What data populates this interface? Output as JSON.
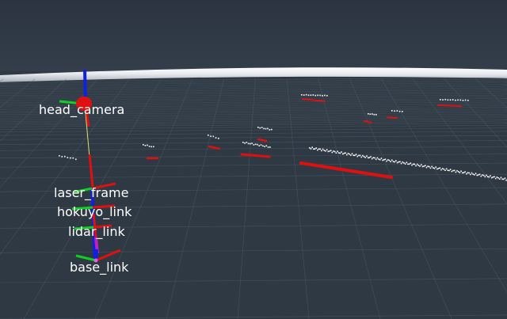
{
  "viewport": {
    "background_color": "#2f3a45",
    "sky_color": "#303947",
    "ground_color": "#2e3943",
    "grid_color": "#566472",
    "horizon_color": "#e6e9ed"
  },
  "frames": [
    {
      "id": "head_camera",
      "label": "head_camera"
    },
    {
      "id": "laser_frame",
      "label": "laser_frame"
    },
    {
      "id": "hokuyo_link",
      "label": "hokuyo_link"
    },
    {
      "id": "lidar_link",
      "label": "lidar_link"
    },
    {
      "id": "base_link",
      "label": "base_link"
    }
  ],
  "markers": {
    "scan_point_color": "#ffffff",
    "projected_scan_color": "#e01010",
    "axis_x_color": "#e01010",
    "axis_y_color": "#10d020",
    "axis_z_color": "#1020e0",
    "tf_link_color": "#e0e070"
  }
}
